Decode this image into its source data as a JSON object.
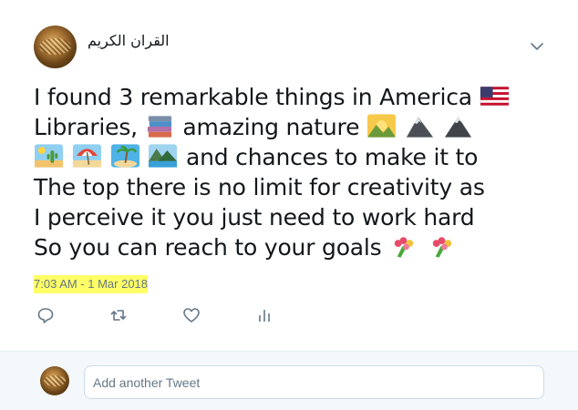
{
  "tweet": {
    "author_name": "القران الكريم",
    "text_lines": [
      "I found 3 remarkable things in America",
      "Libraries,",
      "amazing nature",
      "and chances to make it to",
      "The top there is no limit for creativity as",
      "I perceive it you just need to work hard",
      "So you can reach to your goals"
    ],
    "emoji": {
      "line1": [
        "us-flag"
      ],
      "line2a": [
        "books"
      ],
      "line2b": [
        "sunrise-over-mountains",
        "mountain",
        "mountain"
      ],
      "line3": [
        "desert",
        "beach-with-umbrella",
        "desert-island",
        "national-park"
      ],
      "line7": [
        "bouquet",
        "bouquet"
      ]
    },
    "timestamp": "7:03 AM - 1 Mar 2018",
    "highlight_color": "#ffff66",
    "actions": [
      "reply-icon",
      "retweet-icon",
      "like-icon",
      "analytics-icon"
    ]
  },
  "reply": {
    "placeholder": "Add another Tweet"
  },
  "colors": {
    "text": "#14171a",
    "secondary": "#657786",
    "reply_bar_bg": "#f5f8fa",
    "input_border": "#c8dcec"
  }
}
